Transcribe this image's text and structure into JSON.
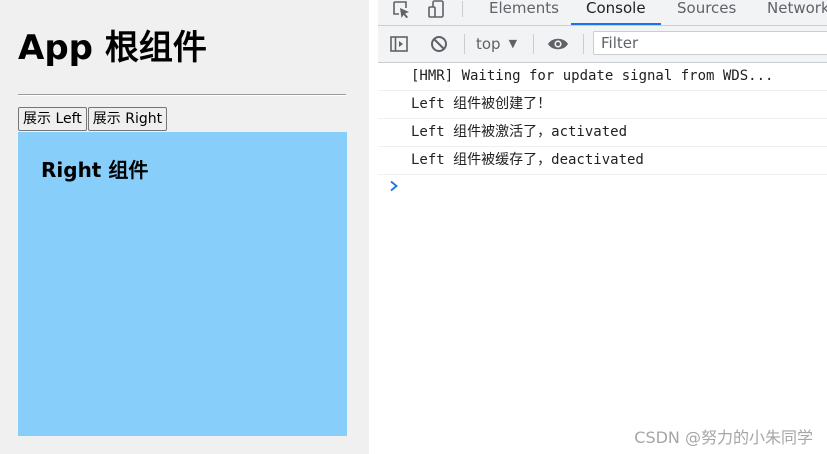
{
  "app": {
    "title": "App 根组件",
    "buttons": {
      "show_left": "展示 Left",
      "show_right": "展示 Right"
    },
    "child": {
      "title": "Right 组件",
      "background": "#87cefa"
    }
  },
  "devtools": {
    "tabs": [
      {
        "label": "Elements",
        "active": false
      },
      {
        "label": "Console",
        "active": true
      },
      {
        "label": "Sources",
        "active": false
      },
      {
        "label": "Network",
        "active": false
      }
    ],
    "toolbar": {
      "context": "top",
      "filter_placeholder": "Filter"
    },
    "console": {
      "messages": [
        "[HMR] Waiting for update signal from WDS...",
        "Left 组件被创建了！",
        "Left 组件被激活了，activated",
        "Left 组件被缓存了，deactivated"
      ]
    },
    "icons": {
      "inspect": "inspect-element-icon",
      "device": "device-toggle-icon",
      "sidebar": "show-console-sidebar-icon",
      "clear": "clear-console-icon",
      "eye": "live-expression-eye-icon",
      "prompt": "console-prompt-chevron-icon"
    },
    "accent": "#1a73e8"
  },
  "watermark": "CSDN @努力的小朱同学"
}
